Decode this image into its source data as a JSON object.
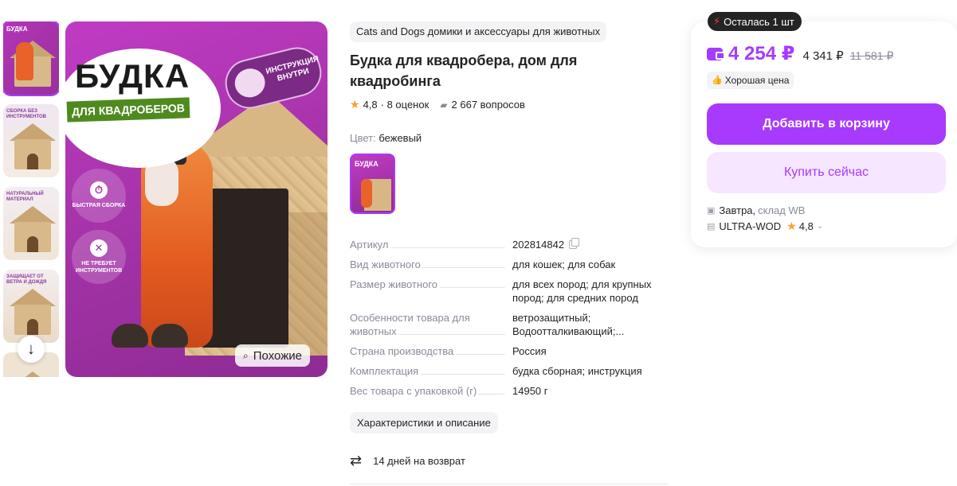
{
  "gallery": {
    "thumb_titles": [
      "БУДКА",
      "СБОРКА БЕЗ ИНСТРУМЕНТОВ",
      "НАТУРАЛЬНЫЙ МАТЕРИАЛ",
      "ЗАЩИЩАЕТ ОТ ВЕТРА И ДОЖДЯ",
      ""
    ],
    "main_title": "БУДКА",
    "main_ribbon": "ДЛЯ КВАДРОБЕРОВ",
    "instruction_badge": "ИНСТРУКЦИЯ ВНУТРИ",
    "feature_1": "БЫСТРАЯ СБОРКА",
    "feature_2": "НЕ ТРЕБУЕТ ИНСТРУМЕНТОВ",
    "similar_button": "Похожие"
  },
  "product": {
    "brand": "Cats and Dogs домики и аксессуары для животных",
    "title": "Будка для квадробера, дом для квадробинга",
    "rating": "4,8",
    "reviews": "· 8 оценок",
    "questions": "2 667 вопросов",
    "color_label": "Цвет:",
    "color_value": "бежевый",
    "swatch_title": "БУДКА"
  },
  "specs": [
    {
      "key": "Артикул",
      "value": "202814842"
    },
    {
      "key": "Вид животного",
      "value": "для кошек; для собак"
    },
    {
      "key": "Размер животного",
      "value": "для всех пород; для крупных пород; для средних пород"
    },
    {
      "key": "Особенности товара для животных",
      "value": "ветрозащитный; Водоотталкивающий;..."
    },
    {
      "key": "Страна производства",
      "value": "Россия"
    },
    {
      "key": "Комплектация",
      "value": "будка сборная; инструкция"
    },
    {
      "key": "Вес товара с упаковкой (г)",
      "value": "14950 г"
    }
  ],
  "description_button": "Характеристики и описание",
  "return_policy": "14 дней на возврат",
  "purchase": {
    "stock_badge": "Осталась 1 шт",
    "price_main": "4 254 ₽",
    "price_second": "4 341 ₽",
    "price_old": "11 581 ₽",
    "good_price": "Хорошая цена",
    "add_to_cart": "Добавить в корзину",
    "buy_now": "Купить сейчас",
    "delivery": "Завтра,",
    "warehouse": "склад WB",
    "seller": "ULTRA-WOD",
    "seller_rating": "4,8"
  },
  "colors": {
    "accent": "#a73afd",
    "accent_light": "#f6e6ff",
    "star": "#ff9b2b",
    "muted_text": "#8b8b9a"
  },
  "icons": {
    "scroll": "arrow-down-icon",
    "similar": "search-image-icon",
    "rating": "star-icon",
    "questions": "comment-icon",
    "copy": "copy-icon",
    "return": "return-arrows-icon",
    "stock": "lightning-icon",
    "wallet": "wallet-icon",
    "good_price": "thumbs-up-icon",
    "delivery": "box-icon",
    "seller": "shop-icon"
  }
}
